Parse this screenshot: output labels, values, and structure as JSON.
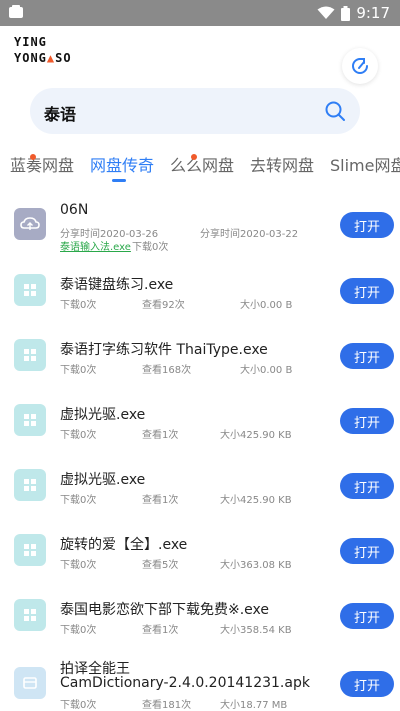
{
  "status_bar": {
    "time": "9:17"
  },
  "logo": {
    "line1": "YING",
    "line2a": "YONG",
    "line2b": "SO"
  },
  "search": {
    "query": "泰语"
  },
  "tabs": [
    {
      "label": "蓝奏网盘"
    },
    {
      "label": "网盘传奇"
    },
    {
      "label": "么么网盘"
    },
    {
      "label": "去转网盘"
    },
    {
      "label": "Slime网盘"
    }
  ],
  "list": {
    "open_label": "打开",
    "items": [
      {
        "title": "06N",
        "shared1": "分享时间2020-03-26",
        "shared2": "分享时间2020-03-22",
        "link": "泰语输入法.exe",
        "downloads": "下载0次",
        "icon": "cloud-icon"
      },
      {
        "title": "泰语键盘练习.exe",
        "downloads": "下载0次",
        "views": "查看92次",
        "size": "大小0.00 B",
        "icon": "windows-icon"
      },
      {
        "title": "泰语打字练习软件 ThaiType.exe",
        "downloads": "下载0次",
        "views": "查看168次",
        "size": "大小0.00 B",
        "icon": "windows-icon"
      },
      {
        "title": "虚拟光驱.exe",
        "downloads": "下载0次",
        "views": "查看1次",
        "size": "大小425.90 KB",
        "icon": "windows-icon"
      },
      {
        "title": "虚拟光驱.exe",
        "downloads": "下载0次",
        "views": "查看1次",
        "size": "大小425.90 KB",
        "icon": "windows-icon"
      },
      {
        "title": "旋转的爱【全】.exe",
        "downloads": "下载0次",
        "views": "查看5次",
        "size": "大小363.08 KB",
        "icon": "windows-icon"
      },
      {
        "title": "泰国电影恋欲下部下载免费※.exe",
        "downloads": "下载0次",
        "views": "查看1次",
        "size": "大小358.54 KB",
        "icon": "windows-icon"
      },
      {
        "title": "拍译全能王",
        "title2": "CamDictionary-2.4.0.20141231.apk",
        "downloads": "下载0次",
        "views": "查看181次",
        "size": "大小18.77 MB",
        "icon": "apk-icon"
      }
    ]
  },
  "colors": {
    "accent": "#2f7ef5",
    "button": "#2f6ee8",
    "statusbar": "#8a8a8a"
  }
}
